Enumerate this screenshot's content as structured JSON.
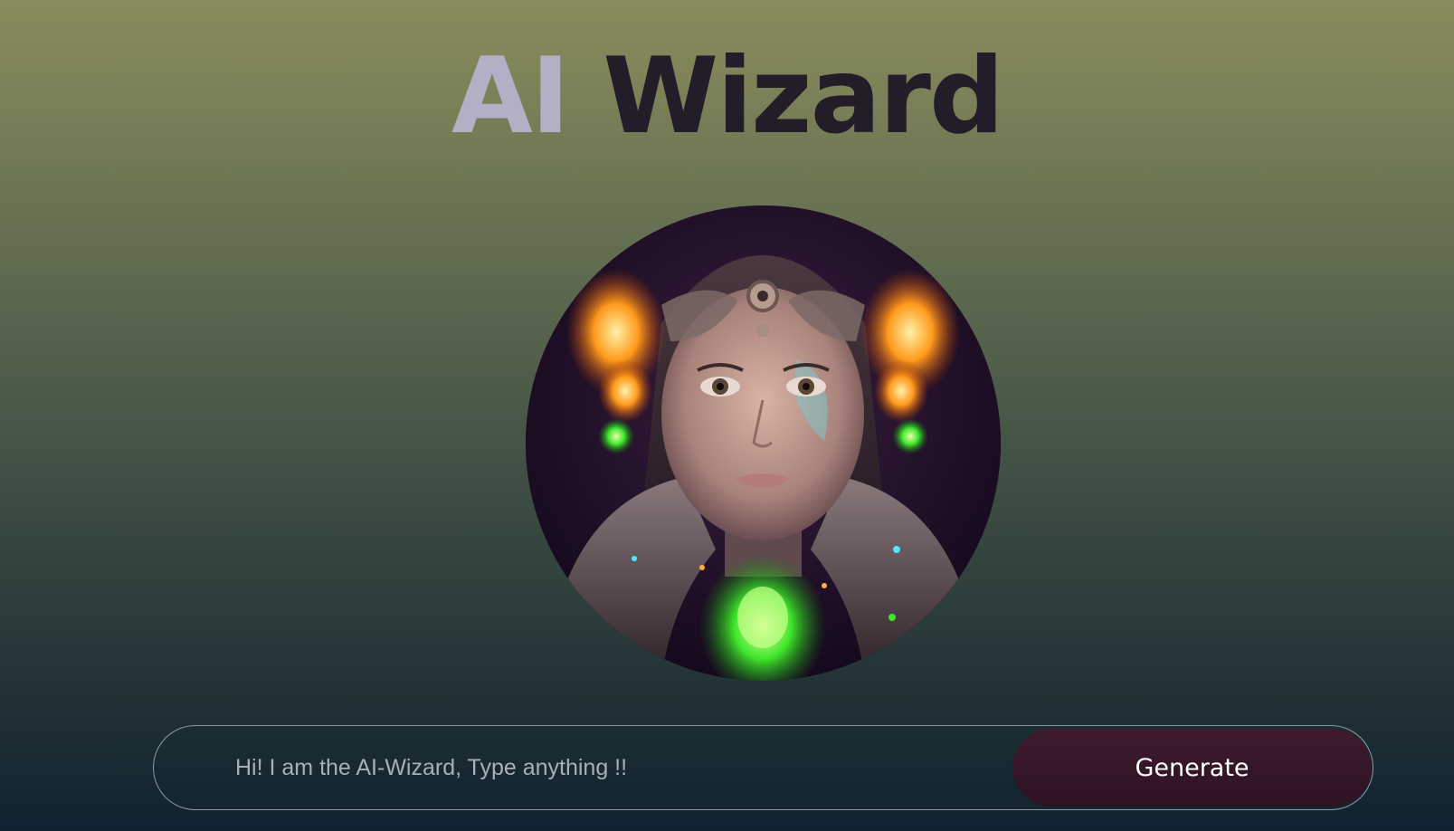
{
  "header": {
    "title_part_a": "AI",
    "title_part_b": "Wizard"
  },
  "portrait": {
    "alt": "AI-Wizard avatar",
    "icon": "cyborg-portrait"
  },
  "prompt": {
    "placeholder": "Hi! I am the AI-Wizard, Type anything !!",
    "value": "",
    "generate_label": "Generate"
  },
  "colors": {
    "title_light": "#b3b0c6",
    "title_dark": "#231d2a",
    "button_bg": "#3f1a30",
    "bg_top": "#8a8c5c",
    "bg_bottom": "#10222f"
  }
}
